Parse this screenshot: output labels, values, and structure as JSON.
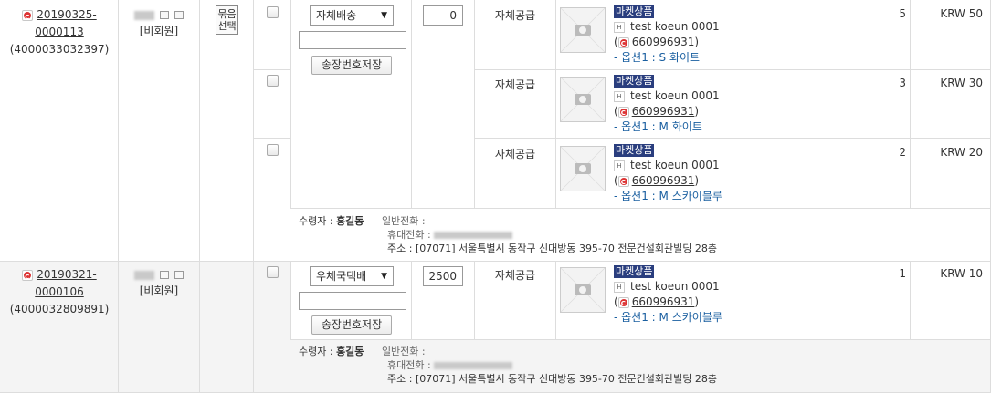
{
  "orders": [
    {
      "order_no_line1": "20190325-",
      "order_no_line2": "0000113",
      "order_id": "(4000033032397)",
      "member": "[비회원]",
      "bundle_label": "묶음\n선택",
      "shipping_method": "자체배송",
      "shipping_fee": "0",
      "save_button": "송장번호저장",
      "items": [
        {
          "supply": "자체공급",
          "tag": "마켓상품",
          "name": "test koeun 0001",
          "product_code": "660996931",
          "option": "- 옵션1 : S 화이트",
          "qty": "5",
          "price": "KRW 50"
        },
        {
          "supply": "자체공급",
          "tag": "마켓상품",
          "name": "test koeun 0001",
          "product_code": "660996931",
          "option": "- 옵션1 : M 화이트",
          "qty": "3",
          "price": "KRW 30"
        },
        {
          "supply": "자체공급",
          "tag": "마켓상품",
          "name": "test koeun 0001",
          "product_code": "660996931",
          "option": "- 옵션1 : M 스카이블루",
          "qty": "2",
          "price": "KRW 20"
        }
      ],
      "receiver": {
        "label": "수령자 :",
        "name": "홍길동",
        "phone_label": "일반전화 :",
        "mobile_label": "휴대전화 :",
        "address": "주소 : [07071] 서울특별시 동작구 신대방동 395-70 전문건설회관빌딩 28층"
      }
    },
    {
      "order_no_line1": "20190321-",
      "order_no_line2": "0000106",
      "order_id": "(4000032809891)",
      "member": "[비회원]",
      "shipping_method": "우체국택배",
      "shipping_fee": "2500",
      "save_button": "송장번호저장",
      "items": [
        {
          "supply": "자체공급",
          "tag": "마켓상품",
          "name": "test koeun 0001",
          "product_code": "660996931",
          "option": "- 옵션1 : M 스카이블루",
          "qty": "1",
          "price": "KRW 10"
        }
      ],
      "receiver": {
        "label": "수령자 :",
        "name": "홍길동",
        "phone_label": "일반전화 :",
        "mobile_label": "휴대전화 :",
        "address": "주소 : [07071] 서울특별시 동작구 신대방동 395-70 전문건설회관빌딩 28층"
      }
    }
  ],
  "colors": {
    "tag_bg": "#2a3e7e",
    "option_text": "#1a5fa0",
    "row2_bg": "#f4f4f4"
  }
}
